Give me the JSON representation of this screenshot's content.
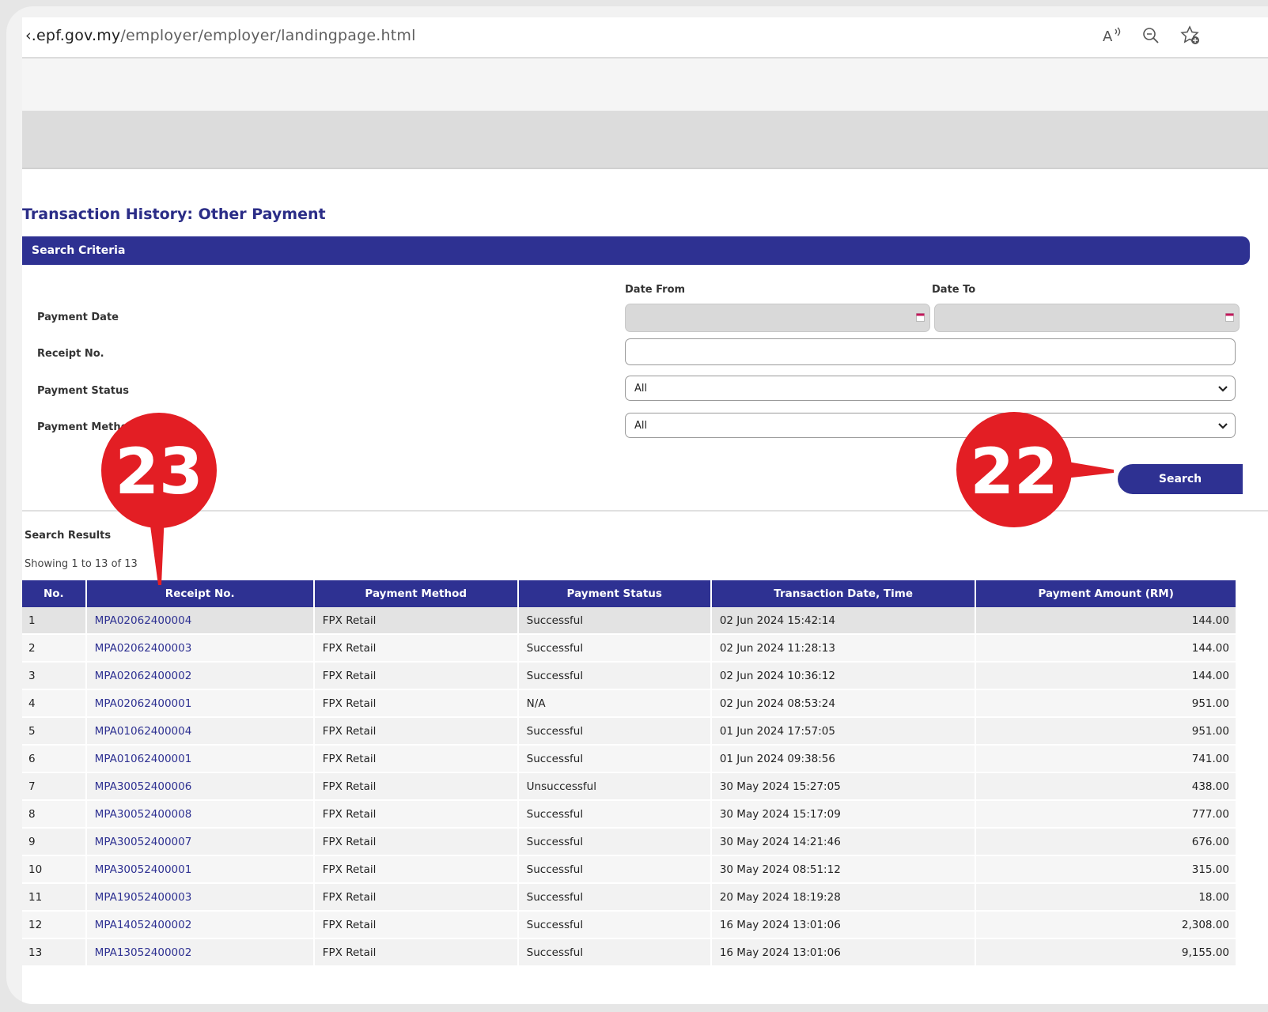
{
  "browser": {
    "url_domain": "‹.epf.gov.my",
    "url_path": "/employer/employer/landingpage.html",
    "icons": [
      "read-aloud-icon",
      "zoom-out-icon",
      "add-favorite-icon"
    ]
  },
  "page": {
    "title": "Transaction History: Other Payment"
  },
  "criteria": {
    "header": "Search Criteria",
    "date_from_label": "Date From",
    "date_to_label": "Date To",
    "payment_date_label": "Payment Date",
    "receipt_no_label": "Receipt No.",
    "payment_status_label": "Payment Status",
    "payment_method_label": "Payment Method",
    "date_from_value": "",
    "date_to_value": "",
    "receipt_no_value": "",
    "payment_status_value": "All",
    "payment_method_value": "All",
    "search_label": "Search"
  },
  "results": {
    "title": "Search Results",
    "showing": "Showing 1 to 13 of 13",
    "columns": [
      "No.",
      "Receipt No.",
      "Payment Method",
      "Payment Status",
      "Transaction Date, Time",
      "Payment Amount (RM)"
    ],
    "rows": [
      [
        "1",
        "MPA02062400004",
        "FPX Retail",
        "Successful",
        "02 Jun 2024 15:42:14",
        "144.00"
      ],
      [
        "2",
        "MPA02062400003",
        "FPX Retail",
        "Successful",
        "02 Jun 2024 11:28:13",
        "144.00"
      ],
      [
        "3",
        "MPA02062400002",
        "FPX Retail",
        "Successful",
        "02 Jun 2024 10:36:12",
        "144.00"
      ],
      [
        "4",
        "MPA02062400001",
        "FPX Retail",
        "N/A",
        "02 Jun 2024 08:53:24",
        "951.00"
      ],
      [
        "5",
        "MPA01062400004",
        "FPX Retail",
        "Successful",
        "01 Jun 2024 17:57:05",
        "951.00"
      ],
      [
        "6",
        "MPA01062400001",
        "FPX Retail",
        "Successful",
        "01 Jun 2024 09:38:56",
        "741.00"
      ],
      [
        "7",
        "MPA30052400006",
        "FPX Retail",
        "Unsuccessful",
        "30 May 2024 15:27:05",
        "438.00"
      ],
      [
        "8",
        "MPA30052400008",
        "FPX Retail",
        "Successful",
        "30 May 2024 15:17:09",
        "777.00"
      ],
      [
        "9",
        "MPA30052400007",
        "FPX Retail",
        "Successful",
        "30 May 2024 14:21:46",
        "676.00"
      ],
      [
        "10",
        "MPA30052400001",
        "FPX Retail",
        "Successful",
        "30 May 2024 08:51:12",
        "315.00"
      ],
      [
        "11",
        "MPA19052400003",
        "FPX Retail",
        "Successful",
        "20 May 2024 18:19:28",
        "18.00"
      ],
      [
        "12",
        "MPA14052400002",
        "FPX Retail",
        "Successful",
        "16 May 2024 13:01:06",
        "2,308.00"
      ],
      [
        "13",
        "MPA13052400002",
        "FPX Retail",
        "Successful",
        "16 May 2024 13:01:06",
        "9,155.00"
      ]
    ]
  },
  "callouts": {
    "search_step": "22",
    "receipt_step": "23"
  },
  "colors": {
    "brand_navy": "#2e3192",
    "callout_red": "#e31e24"
  }
}
